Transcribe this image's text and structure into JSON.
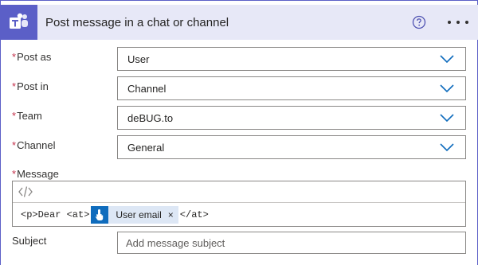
{
  "header": {
    "title": "Post message in a chat or channel",
    "app_icon": "teams-logo",
    "help_icon": "help-circle-icon",
    "more_icon": "ellipsis-icon",
    "accent": "#5b5fc7",
    "background": "#e7e8f7"
  },
  "required_marker": "*",
  "fields": {
    "post_as": {
      "label": "Post as",
      "value": "User"
    },
    "post_in": {
      "label": "Post in",
      "value": "Channel"
    },
    "team": {
      "label": "Team",
      "value": "deBUG.to"
    },
    "channel": {
      "label": "Channel",
      "value": "General"
    }
  },
  "message": {
    "label": "Message",
    "code_toggle_glyph": "</>",
    "prefix": "<p>Dear <at>",
    "token": {
      "label": "User email",
      "remove": "×"
    },
    "suffix": "</at>"
  },
  "subject": {
    "label": "Subject",
    "placeholder": "Add message subject"
  },
  "colors": {
    "required": "#c4314b",
    "chevron": "#0f6cbd",
    "token_bg": "#dde7f5",
    "token_icon_bg": "#0f6cbd"
  }
}
